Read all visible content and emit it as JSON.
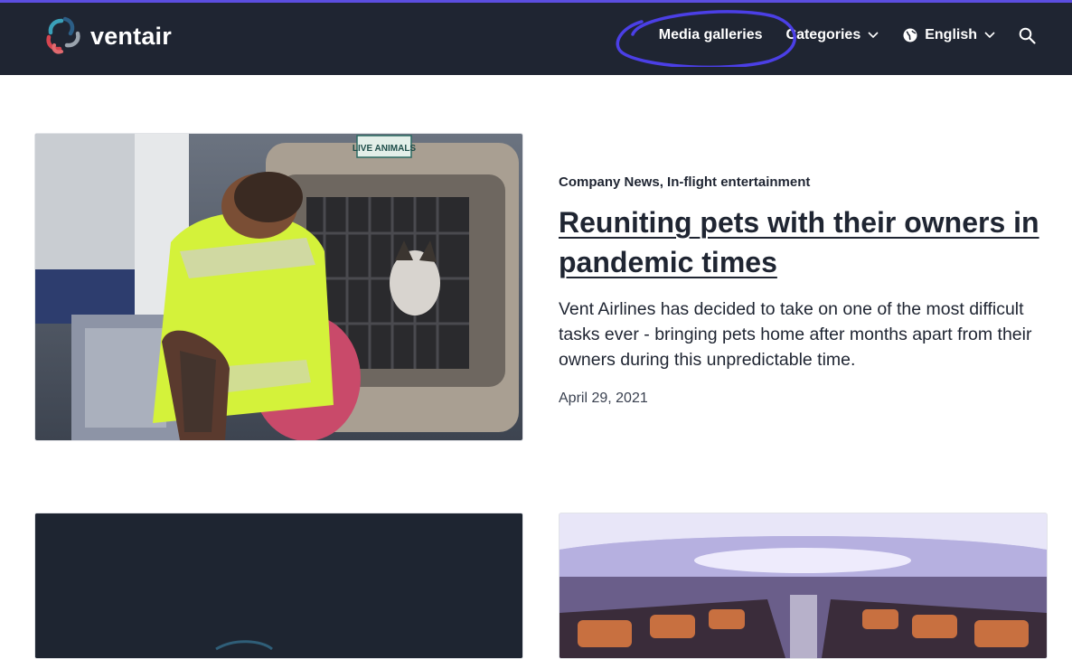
{
  "header": {
    "logo_text": "ventair",
    "nav": {
      "media_galleries": "Media galleries",
      "categories": "Categories",
      "language": "English"
    }
  },
  "featured": {
    "categories": [
      "Company News",
      "In-flight entertainment"
    ],
    "separator": ",",
    "title": "Reuniting pets with their owners in pandemic times",
    "excerpt": "Vent Airlines has decided to take on one of the most difficult tasks ever - bringing pets home after months apart from their owners during this unpredictable time.",
    "date": "April 29, 2021",
    "image_text": "LIVE ANIMALS"
  },
  "colors": {
    "navbar_bg": "#1f2532",
    "accent_line": "#5b4ee0",
    "annotation": "#4b3fe6",
    "text": "#1f2532"
  }
}
